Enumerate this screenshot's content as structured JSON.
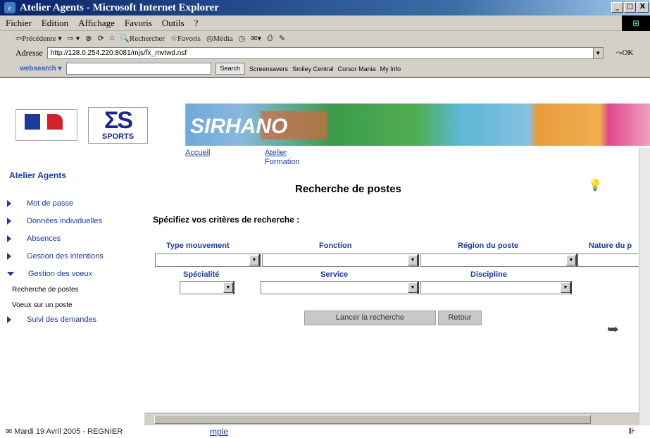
{
  "window": {
    "title": "Atelier Agents - Microsoft Internet Explorer",
    "buttons": [
      "_",
      "□",
      "X"
    ]
  },
  "menu": [
    "Fichier",
    "Edition",
    "Affichage",
    "Favoris",
    "Outils",
    "?"
  ],
  "toolbar": {
    "back": "⇦Précédente ▾",
    "forward": "⇨ ▾",
    "search": "Rechercher",
    "favorites": "Favoris",
    "media": "Média"
  },
  "address": {
    "label": "Adresse",
    "url": "http://128.0.254.220:8081/mjs/fx_mvtwd.nsf",
    "ok": "OK"
  },
  "searchbar": {
    "brand": "websearch ▾",
    "search_button": "Search",
    "links": [
      "Screensavers",
      "Smiley Central",
      "Cursor Mania",
      "My Info"
    ]
  },
  "banner": {
    "sports": "SPORTS",
    "site": "SIRHANO"
  },
  "nav": {
    "accueil": "Accueil",
    "atelier": "Atelier",
    "formation": "Formation"
  },
  "sidebar": {
    "title": "Atelier Agents",
    "items": [
      {
        "label": "Mot de passe"
      },
      {
        "label": "Données individuelles"
      },
      {
        "label": "Absences"
      },
      {
        "label": "Gestion des intentions"
      },
      {
        "label": "Gestion des voeux"
      },
      {
        "label": "Suivi des demandes"
      }
    ],
    "subitems": [
      "Recherche de postes",
      "Voeux sur un poste"
    ]
  },
  "main": {
    "title": "Recherche de postes",
    "criteria_heading": "Spécifiez vos critères de recherche :",
    "fields": {
      "type_mouvement": "Type mouvement",
      "fonction": "Fonction",
      "region": "Région du poste",
      "nature": "Nature du p",
      "specialite": "Spécialité",
      "service": "Service",
      "discipline": "Discipline"
    },
    "search_button": "Lancer la recherche",
    "back_button": "Retour"
  },
  "status": {
    "text": "Mardi 19 Avril 2005 - REGNIER",
    "link": "mple"
  }
}
